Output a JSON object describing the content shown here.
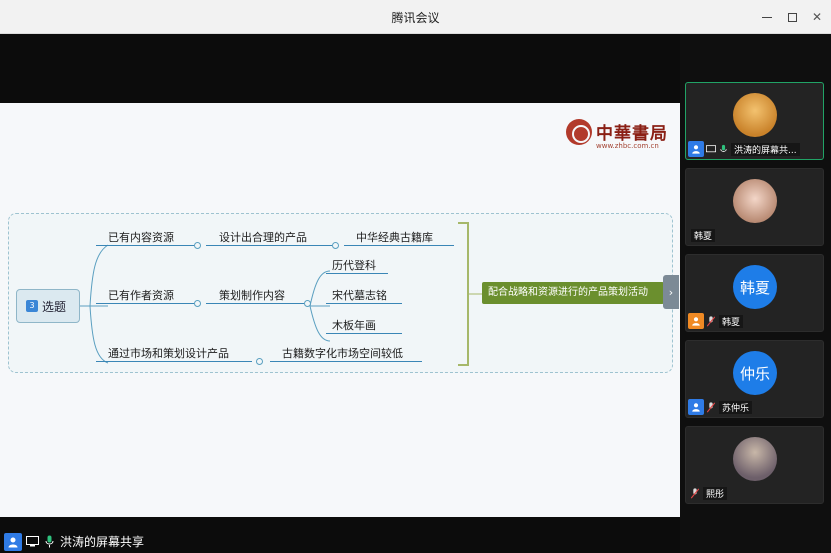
{
  "window": {
    "title": "腾讯会议"
  },
  "slide": {
    "logo": {
      "brand": "中華書局",
      "url": "www.zhbc.com.cn"
    },
    "root": {
      "number": "3",
      "label": "选题"
    },
    "branches": [
      {
        "label": "已有内容资源",
        "middle": "设计出合理的产品",
        "leaves": [
          "中华经典古籍库"
        ]
      },
      {
        "label": "已有作者资源",
        "middle": "策划制作内容",
        "leaves": [
          "历代登科",
          "宋代墓志铭",
          "木板年画"
        ]
      },
      {
        "label": "通过市场和策划设计产品",
        "middle": "古籍数字化市场空间较低",
        "leaves": []
      }
    ],
    "result": "配合战略和资源进行的产品策划活动"
  },
  "status": {
    "sharer": "洪涛的屏幕共享"
  },
  "participants": [
    {
      "name": "洪涛的屏幕共...",
      "avatar_type": "photo",
      "active": true
    },
    {
      "name": "韩夏",
      "avatar_type": "photo",
      "active": false
    },
    {
      "name": "韩夏",
      "avatar_text": "韩夏",
      "avatar_type": "text",
      "active": false
    },
    {
      "name": "苏仲乐",
      "avatar_text": "仲乐",
      "avatar_type": "text",
      "active": false
    },
    {
      "name": "熙彤",
      "avatar_type": "photo",
      "active": false
    }
  ],
  "colors": {
    "accent": "#2f7be6",
    "active_border": "#21a366",
    "result_node": "#6b8f2e",
    "seal": "#b23a2b"
  }
}
